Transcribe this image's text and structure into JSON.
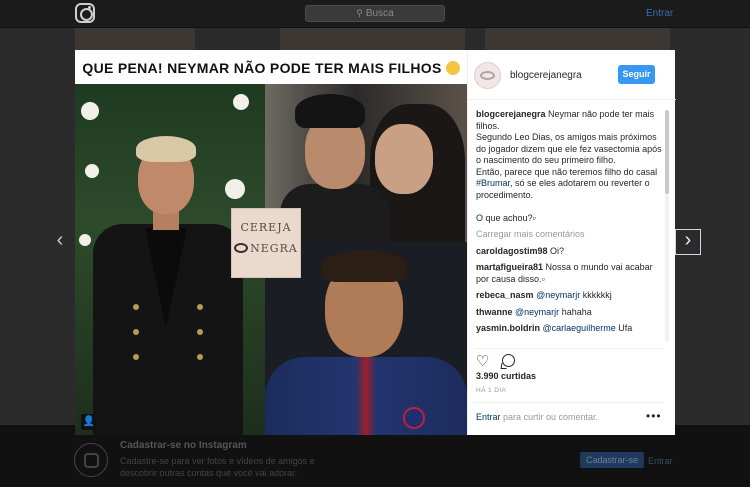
{
  "header": {
    "search_placeholder": "Busca",
    "login_label": "Entrar"
  },
  "post": {
    "banner_text": "QUE PENA! NEYMAR NÃO PODE TER MAIS FILHOS",
    "logo_line1": "CEREJA",
    "logo_line2": "NEGRA"
  },
  "sidebar": {
    "username": "blogcerejanegra",
    "follow_label": "Seguir",
    "caption_user": "blogcerejanegra",
    "caption_1": " Neymar não pode ter mais filhos.",
    "caption_2": "Segundo Leo Dias, os amigos mais próximos do jogador dizem que ele fez vasectomia após o nascimento do seu primeiro filho.",
    "caption_3a": "Então, parece que não teremos filho do casal ",
    "caption_hashtag": "#Brumar",
    "caption_3b": ", só se eles adotarem ou reverter o procedimento.",
    "caption_4": "O que achou?▫",
    "load_more": "Carregar mais comentários",
    "comments": [
      {
        "user": "caroldagostim98",
        "pre": " Oi?",
        "mention": "",
        "post": ""
      },
      {
        "user": "marta̲figueira81",
        "pre": " Nossa o mundo vai acabar por causa disso.▫",
        "mention": "",
        "post": ""
      },
      {
        "user": "rebeca_nasm",
        "pre": " ",
        "mention": "@neymarjr",
        "post": " kkkkkkj"
      },
      {
        "user": "thwanne",
        "pre": " ",
        "mention": "@neymarjr",
        "post": " hahaha"
      },
      {
        "user": "yasmin.boldrin",
        "pre": " ",
        "mention": "@carlaeguilherme",
        "post": " Ufa"
      }
    ],
    "likes": "3.990 curtidas",
    "time": "HÁ 1 DIA",
    "login_link": "Entrar",
    "login_rest": " para curtir ou comentar.",
    "more": "•••"
  },
  "footer": {
    "title": "Cadastrar-se no Instagram",
    "subtitle": "Cadastre-se para ver fotos e vídeos de amigos e descobrir outras contas que você vai adorar.",
    "signup_label": "Cadastrar-se",
    "login_label": "Entrar"
  },
  "colors": {
    "follow_button": "#3897f0",
    "link": "#003569"
  }
}
